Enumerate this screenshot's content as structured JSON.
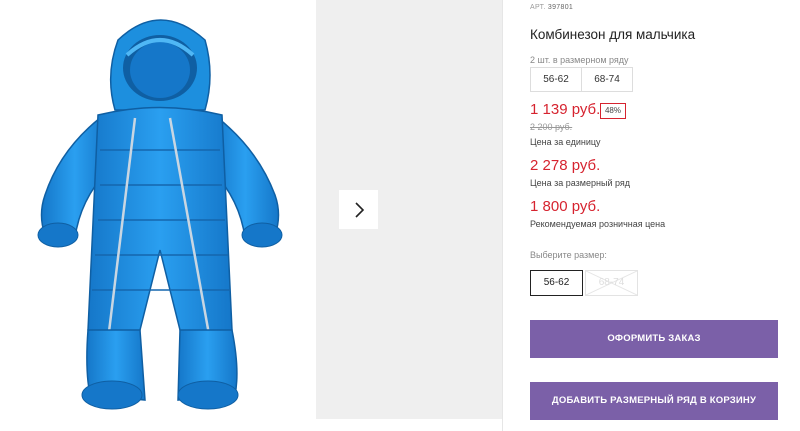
{
  "product": {
    "article_label": "АРТ.",
    "article_number": "397801",
    "title": "Комбинезон для мальчика",
    "range_hint": "2 шт. в размерном ряду",
    "range_sizes": [
      "56-62",
      "68-74"
    ]
  },
  "pricing": {
    "unit_price": "1 139 руб.",
    "discount_badge": "48%",
    "old_price": "2 200 руб.",
    "unit_price_label": "Цена за единицу",
    "range_price": "2 278 руб.",
    "range_price_label": "Цена за размерный ряд",
    "retail_price": "1 800 руб.",
    "retail_price_label": "Рекомендуемая розничная цена"
  },
  "size_selector": {
    "label": "Выберите размер:",
    "selected": "56-62",
    "unavailable": "68-74"
  },
  "actions": {
    "checkout_label": "ОФОРМИТЬ ЗАКАЗ",
    "add_range_label": "ДОБАВИТЬ РАЗМЕРНЫЙ РЯД В КОРЗИНУ"
  },
  "colors": {
    "price_red": "#d6232f",
    "button_purple": "#7b60a8",
    "suit_blue": "#1d8fde"
  },
  "icons": {
    "gallery_next": "chevron-right-icon"
  }
}
